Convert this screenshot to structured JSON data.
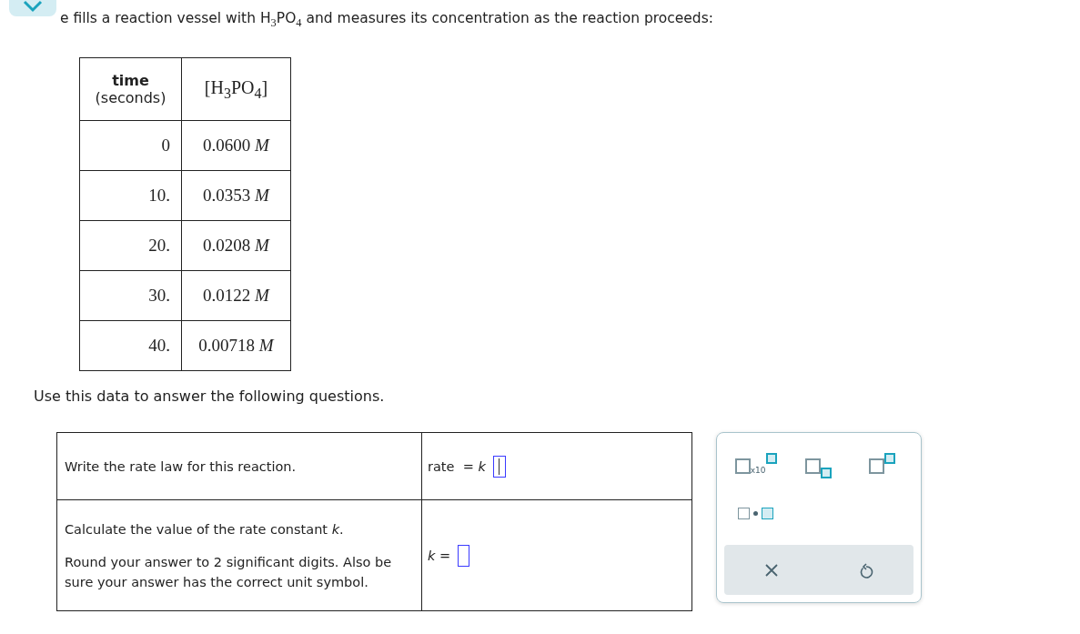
{
  "intro": "e fills a reaction vessel with H$_{3}$PO$_{4}$ and measures its concentration as the reaction proceeds:",
  "data_table": {
    "columns": [
      {
        "title": "time",
        "subtitle": "(seconds)"
      },
      {
        "title": "[H$_{3}$PO$_{4}$]"
      }
    ],
    "rows": [
      [
        "0",
        "0.0600 *M*"
      ],
      [
        "10.",
        "0.0353 *M*"
      ],
      [
        "20.",
        "0.0208 *M*"
      ],
      [
        "30.",
        "0.0122 *M*"
      ],
      [
        "40.",
        "0.00718 *M*"
      ]
    ]
  },
  "instruction": "Use this data to answer the following questions.",
  "questions": [
    {
      "prompts": [
        "Write the rate law for this reaction."
      ],
      "answer_label": "rate  = *k*",
      "focused": true
    },
    {
      "prompts": [
        "Calculate the value of the rate constant *k*.",
        "Round your answer to 2 significant digits. Also be sure your answer has the correct unit symbol."
      ],
      "answer_label": "*k* =",
      "focused": false
    }
  ],
  "palette": {
    "buttons": [
      {
        "kind": "times-ten",
        "label": "x10"
      },
      {
        "kind": "subscript"
      },
      {
        "kind": "superscript"
      },
      {
        "kind": "dot"
      }
    ],
    "actions": [
      {
        "kind": "clear"
      },
      {
        "kind": "undo"
      }
    ]
  }
}
